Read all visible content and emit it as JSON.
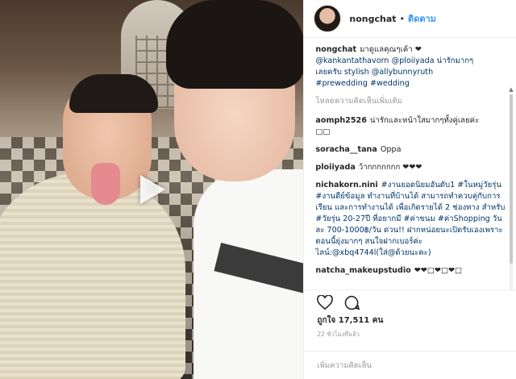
{
  "post": {
    "username": "nongchat",
    "follow_label": "ติดตาม",
    "dot": "•"
  },
  "comments": [
    {
      "user": "nongchat",
      "text": "มาดูแลคุณๆเค้า ❤",
      "extra": [
        "@kankantathavorn @ploiiyada น่ารักมากๆ",
        "เลยครับ stylish @allybunnyruth",
        "#prewedding #wedding"
      ]
    },
    {
      "user": "aomph2526",
      "text": "น่ารักและหน้าใสมากๆทั้งคู่เลยค่ะ",
      "extra2": "□□"
    },
    {
      "user": "soracha__tana",
      "text": "Oppa"
    },
    {
      "user": "ploiiyada",
      "text": "ว้ากกกกกกก ❤❤❤"
    },
    {
      "user": "nichakorn.nini",
      "text": "#งานยอดนิยมอันดับ1 #ในหมู่วัยรุ่น #งานดีย์ข้อมูล ทำงานที่บ้านได้ สามารถทำควบคู่กับการเรียน และการทำงานได้ เพื่อเกิดรายได้ 2 ช่องทาง สำหรับ #วัยรุ่น 20-27ปี ที่อยากมี #ค่าขนม #ค่าShopping วันละ 700-1000฿/วัน ด่วน!! ฝากหน่อยนะเปิดรับเองเพราะตอนนี้ยุ่งมากๆ สนใจฝากเบอร์ค่ะ ไลน์:@xbq4744l(ใส่@ด้วยนะคะ)"
    },
    {
      "user": "natcha_makeupstudio",
      "text": "❤❤□❤□❤□"
    }
  ],
  "load_more": "โหลดความคิดเห็นเพิ่มเติม",
  "likes": "ถูกใจ 17,511 คน",
  "time_ago": "22 ชั่วโมงที่แล้ว",
  "add_comment_placeholder": "เพิ่มความคิดเห็น",
  "icons": {
    "heart": "heart-icon",
    "comment": "comment-icon",
    "play": "play-icon"
  },
  "colors": {
    "link": "#003569",
    "follow": "#3897f0",
    "muted": "#999999"
  }
}
